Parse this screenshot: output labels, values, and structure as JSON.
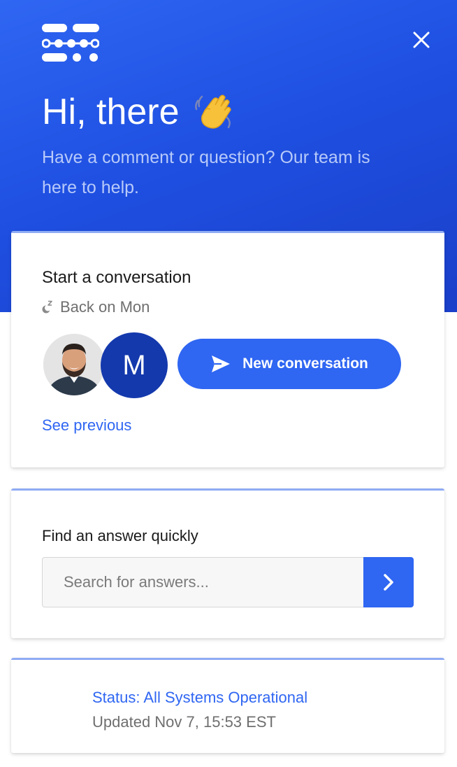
{
  "colors": {
    "brand_blue": "#2f66f2",
    "hero_gradient_start": "#2f66f2",
    "hero_gradient_end": "#1a3fc9",
    "avatar_m_bg": "#1439ad",
    "subtitle_text": "#b8caf9",
    "muted_text": "#6f6f6f"
  },
  "header": {
    "logo_icon": "brand-logo-icon",
    "close_icon": "close-icon",
    "greeting": "Hi, there",
    "greeting_emoji": "waving-hand-icon",
    "subtitle": "Have a comment or question? Our team is here to help."
  },
  "conversation_card": {
    "title": "Start a conversation",
    "away_icon": "sleep-icon",
    "availability": "Back on Mon",
    "avatars": [
      {
        "type": "photo",
        "name": "team-member-photo"
      },
      {
        "type": "initial",
        "initial": "M"
      }
    ],
    "new_conversation_label": "New conversation",
    "new_conversation_icon": "send-icon",
    "see_previous_label": "See previous"
  },
  "search_card": {
    "title": "Find an answer quickly",
    "placeholder": "Search for answers...",
    "submit_icon": "chevron-right-icon"
  },
  "status_card": {
    "status_text": "Status: All Systems Operational",
    "updated_text": "Updated Nov 7, 15:53 EST"
  }
}
